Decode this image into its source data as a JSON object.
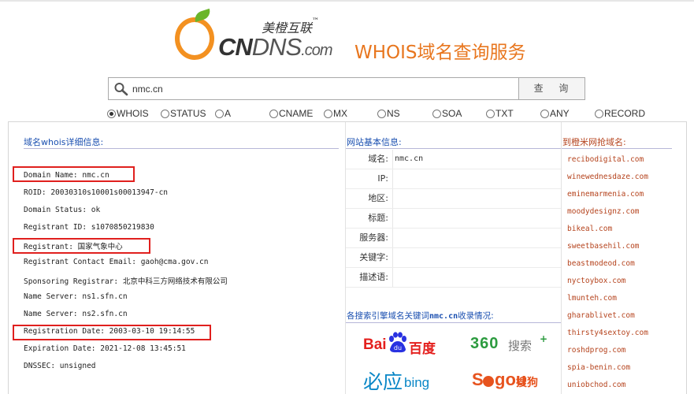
{
  "header": {
    "brand_cn": "美橙互联",
    "brand_tm": "™",
    "brand_en_bold": "CN",
    "brand_en_light": "DNS",
    "brand_en_suffix": ".com",
    "service_title": "WHOIS域名查询服务",
    "logo_color": "#f39121",
    "accent_color": "#e8761e"
  },
  "search": {
    "value": "nmc.cn",
    "button_label": "查 询"
  },
  "options": [
    {
      "label": "WHOIS",
      "checked": true
    },
    {
      "label": "STATUS",
      "checked": false
    },
    {
      "label": "A",
      "checked": false
    },
    {
      "label": "CNAME",
      "checked": false
    },
    {
      "label": "MX",
      "checked": false
    },
    {
      "label": "NS",
      "checked": false
    },
    {
      "label": "SOA",
      "checked": false
    },
    {
      "label": "TXT",
      "checked": false
    },
    {
      "label": "ANY",
      "checked": false
    },
    {
      "label": "RECORD",
      "checked": false
    }
  ],
  "whois": {
    "title": "域名whois详细信息:",
    "lines": [
      "Domain Name: nmc.cn",
      "ROID: 20030310s10001s00013947-cn",
      "Domain Status: ok",
      "Registrant ID: s1070850219830",
      "Registrant: 国家气象中心",
      "Registrant Contact Email: gaoh@cma.gov.cn",
      "Sponsoring Registrar: 北京中科三方网络技术有限公司",
      "Name Server: ns1.sfn.cn",
      "Name Server: ns2.sfn.cn",
      "Registration Date: 2003-03-10 19:14:55",
      "Expiration Date: 2021-12-08 13:45:51",
      "DNSSEC: unsigned"
    ],
    "highlight_color": "#e0201e"
  },
  "site_info": {
    "title": "网站基本信息:",
    "rows": [
      {
        "label": "域名:",
        "value": "nmc.cn"
      },
      {
        "label": "IP:",
        "value": ""
      },
      {
        "label": "地区:",
        "value": ""
      },
      {
        "label": "标题:",
        "value": ""
      },
      {
        "label": "服务器:",
        "value": ""
      },
      {
        "label": "关键字:",
        "value": ""
      },
      {
        "label": "描述语:",
        "value": ""
      }
    ],
    "se_prefix": "各搜索引擎域名关键词",
    "se_domain": "nmc.cn",
    "se_suffix": "收录情况:"
  },
  "engines": {
    "baidu_text": "Bai",
    "baidu_cn": "百度",
    "s360_num": "360",
    "s360_cn": "搜索",
    "s360_plus": "+",
    "bing_cn": "必应",
    "bing_en": "bing",
    "sogou_s": "S",
    "sogou_g": "gou",
    "sogou_cn": "搜狗"
  },
  "domains": {
    "title": "到橙米网抢域名:",
    "items": [
      "recibodigital.com",
      "winewednesdaze.com",
      "eminemarmenia.com",
      "moodydesignz.com",
      "bikeal.com",
      "sweetbasehil.com",
      "beastmodeod.com",
      "nyctoybox.com",
      "lmunteh.com",
      "gharablivet.com",
      "thirsty4sextoy.com",
      "roshdprog.com",
      "spia-benin.com",
      "uniobchod.com"
    ],
    "link_color": "#b5431d"
  }
}
